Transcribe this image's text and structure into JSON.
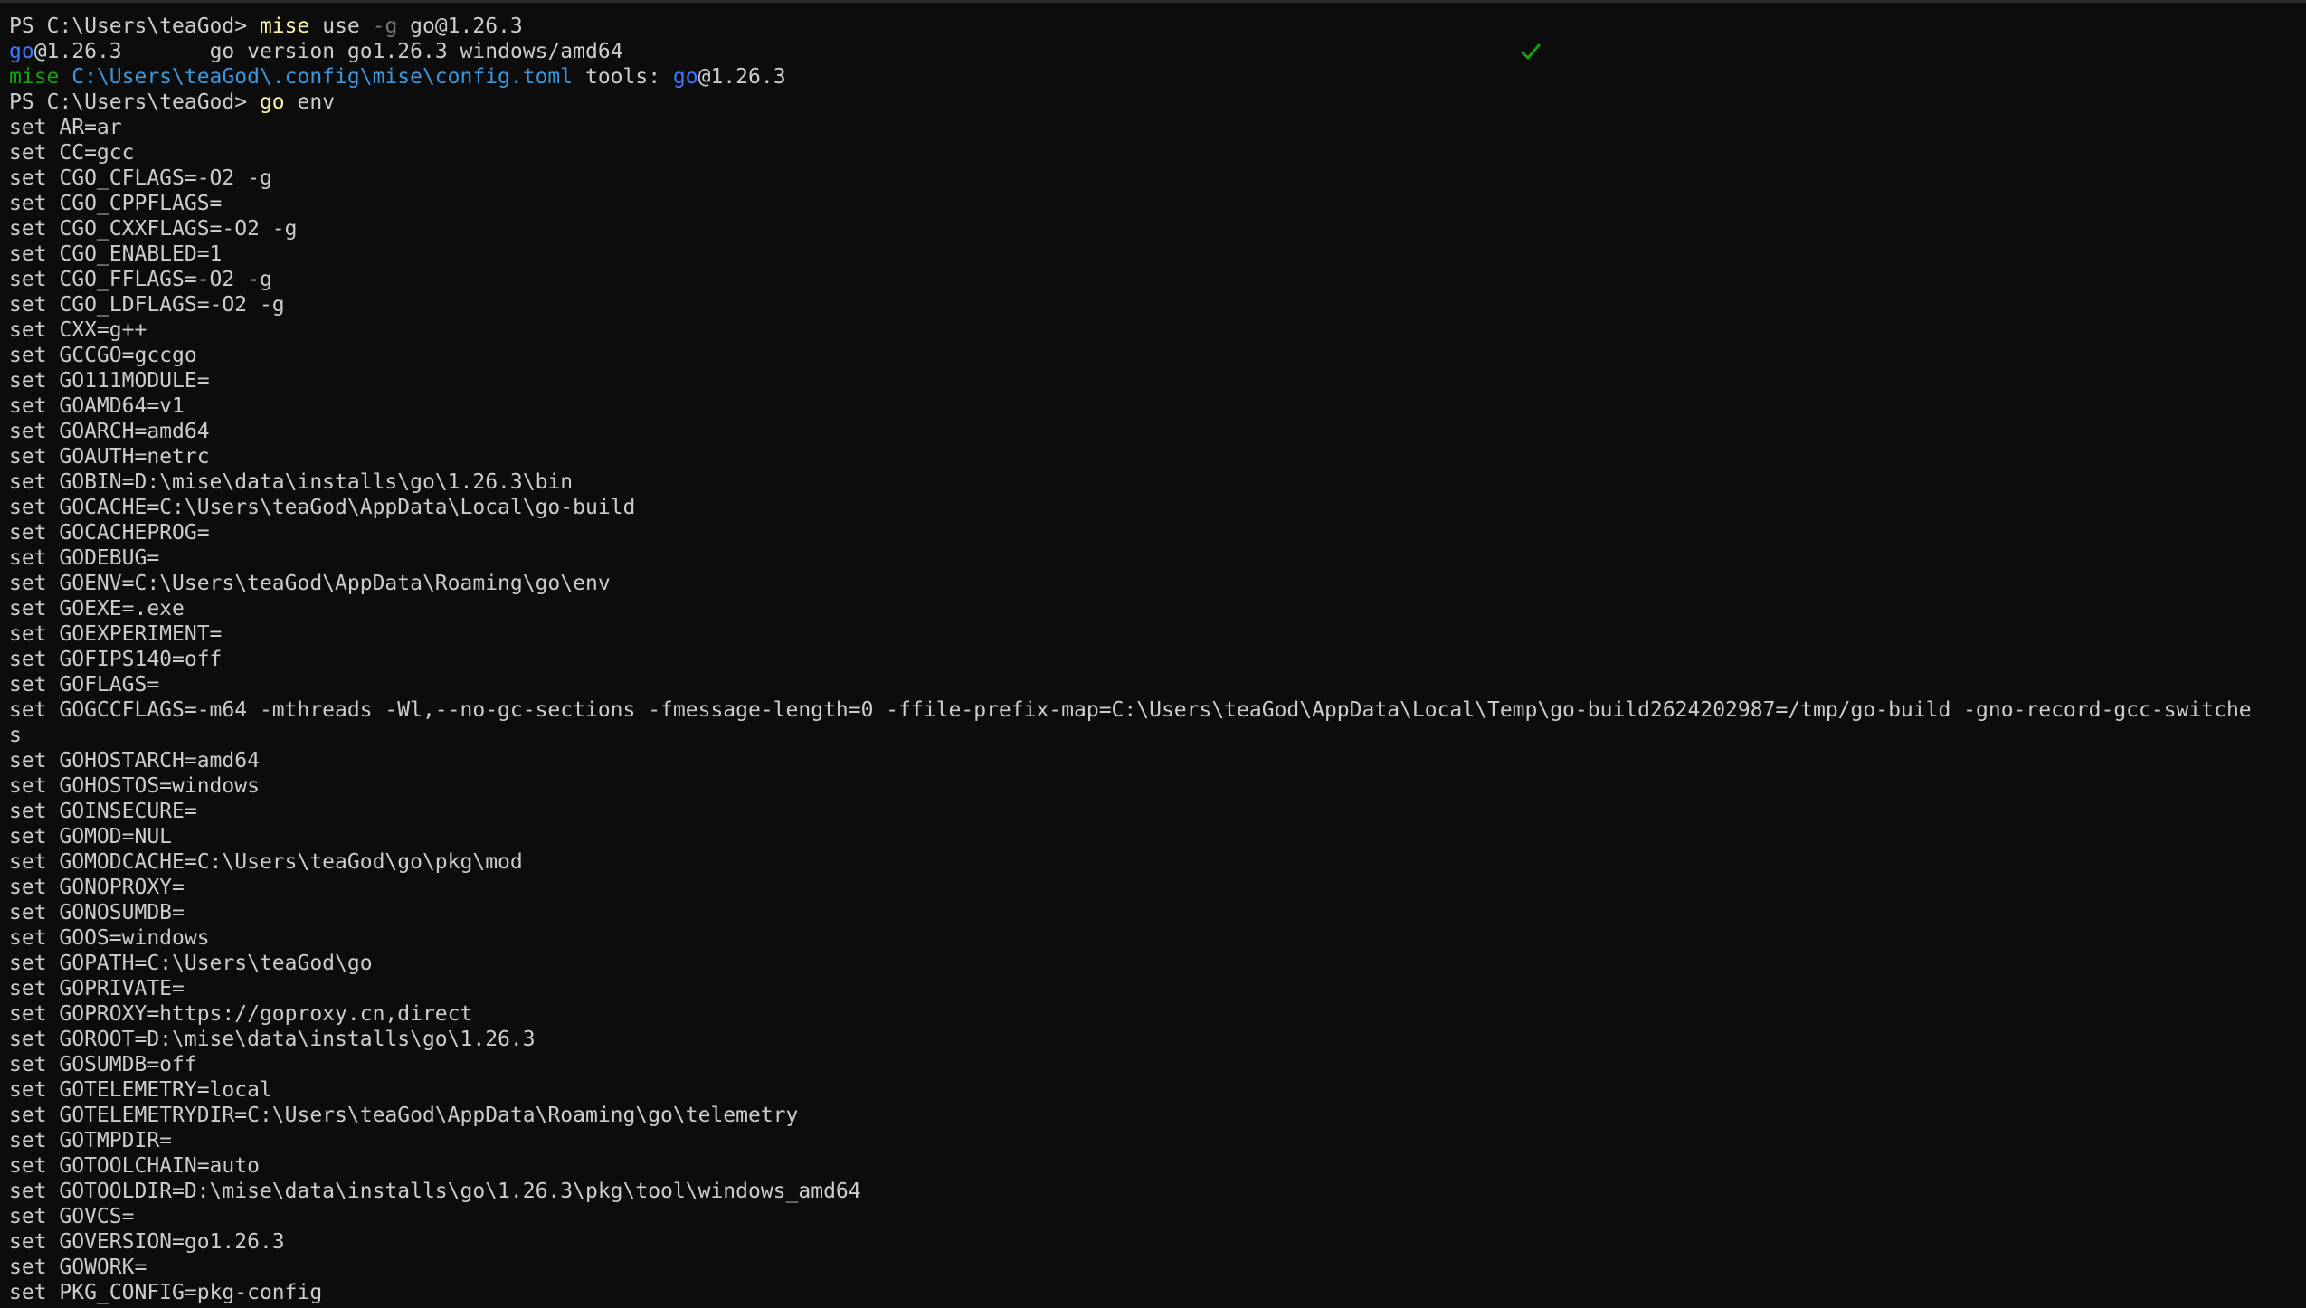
{
  "prompt1": {
    "text": "PS C:\\Users\\teaGod> ",
    "cmd": "mise",
    "sub": " use ",
    "flag": "-g",
    "arg": " go@1.26.3"
  },
  "mise_result": {
    "tool": "go",
    "version": "@1.26.3",
    "gap": "       ",
    "output": "go version go1.26.3 windows/amd64",
    "status_icon": "check-icon",
    "status_color": "#13a10e"
  },
  "mise_config": {
    "prefix": "mise",
    "path": " C:\\Users\\teaGod\\.config\\mise\\config.toml",
    "middle": " tools: ",
    "tool": "go",
    "version": "@1.26.3"
  },
  "prompt2": {
    "text": "PS C:\\Users\\teaGod> ",
    "cmd": "go",
    "arg": " env"
  },
  "env_lines": [
    "set AR=ar",
    "set CC=gcc",
    "set CGO_CFLAGS=-O2 -g",
    "set CGO_CPPFLAGS=",
    "set CGO_CXXFLAGS=-O2 -g",
    "set CGO_ENABLED=1",
    "set CGO_FFLAGS=-O2 -g",
    "set CGO_LDFLAGS=-O2 -g",
    "set CXX=g++",
    "set GCCGO=gccgo",
    "set GO111MODULE=",
    "set GOAMD64=v1",
    "set GOARCH=amd64",
    "set GOAUTH=netrc",
    "set GOBIN=D:\\mise\\data\\installs\\go\\1.26.3\\bin",
    "set GOCACHE=C:\\Users\\teaGod\\AppData\\Local\\go-build",
    "set GOCACHEPROG=",
    "set GODEBUG=",
    "set GOENV=C:\\Users\\teaGod\\AppData\\Roaming\\go\\env",
    "set GOEXE=.exe",
    "set GOEXPERIMENT=",
    "set GOFIPS140=off",
    "set GOFLAGS=",
    "set GOGCCFLAGS=-m64 -mthreads -Wl,--no-gc-sections -fmessage-length=0 -ffile-prefix-map=C:\\Users\\teaGod\\AppData\\Local\\Temp\\go-build2624202987=/tmp/go-build -gno-record-gcc-switche",
    "s",
    "set GOHOSTARCH=amd64",
    "set GOHOSTOS=windows",
    "set GOINSECURE=",
    "set GOMOD=NUL",
    "set GOMODCACHE=C:\\Users\\teaGod\\go\\pkg\\mod",
    "set GONOPROXY=",
    "set GONOSUMDB=",
    "set GOOS=windows",
    "set GOPATH=C:\\Users\\teaGod\\go",
    "set GOPRIVATE=",
    "set GOPROXY=https://goproxy.cn,direct",
    "set GOROOT=D:\\mise\\data\\installs\\go\\1.26.3",
    "set GOSUMDB=off",
    "set GOTELEMETRY=local",
    "set GOTELEMETRYDIR=C:\\Users\\teaGod\\AppData\\Roaming\\go\\telemetry",
    "set GOTMPDIR=",
    "set GOTOOLCHAIN=auto",
    "set GOTOOLDIR=D:\\mise\\data\\installs\\go\\1.26.3\\pkg\\tool\\windows_amd64",
    "set GOVCS=",
    "set GOVERSION=go1.26.3",
    "set GOWORK=",
    "set PKG_CONFIG=pkg-config"
  ],
  "colors": {
    "background": "#0c0c0c",
    "foreground": "#cccccc",
    "command": "#f9f1a5",
    "flag": "#767676",
    "mise": "#13a10e",
    "tool": "#3b78ff",
    "path": "#3a96dd"
  }
}
